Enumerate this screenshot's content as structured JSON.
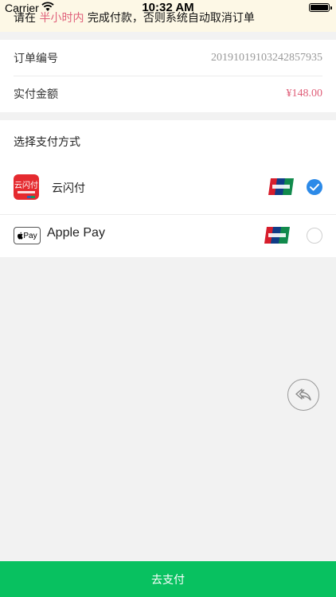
{
  "status_bar": {
    "carrier": "Carrier",
    "time": "10:32 AM"
  },
  "notice": {
    "prefix": "请在",
    "highlight": "半小时内",
    "suffix": "完成付款，否则系统自动取消订单"
  },
  "order": {
    "number_label": "订单编号",
    "number_value": "20191019103242857935",
    "amount_label": "实付金额",
    "amount_value": "¥148.00"
  },
  "payment": {
    "title": "选择支付方式",
    "methods": [
      {
        "label": "云闪付",
        "logo_text": "云闪付",
        "selected": true,
        "icon": "yunshanfu-logo"
      },
      {
        "label": "Apple Pay",
        "logo_text": "Pay",
        "selected": false,
        "icon": "apple-pay-logo"
      }
    ]
  },
  "colors": {
    "accent_green": "#08c160",
    "highlight_pink": "#e0607a",
    "selected_blue": "#2c8ae8"
  },
  "actions": {
    "pay_label": "去支付"
  }
}
